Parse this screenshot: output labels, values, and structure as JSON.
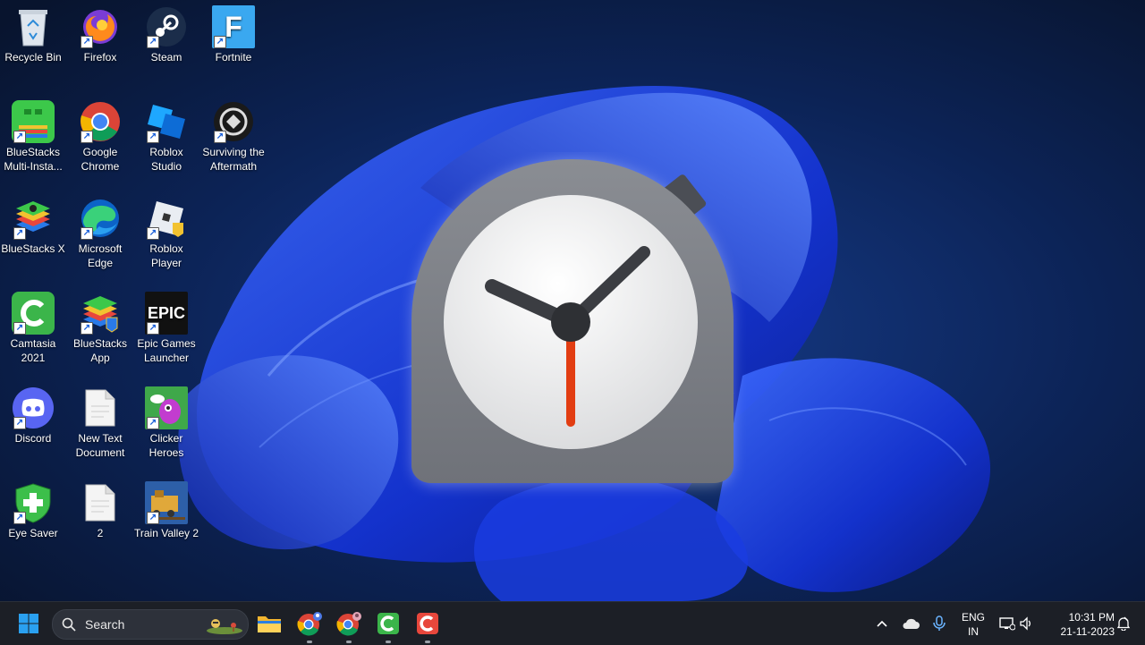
{
  "desktop": {
    "icons": [
      {
        "label": "Recycle Bin",
        "icon": "recycle-bin-icon"
      },
      {
        "label": "Firefox",
        "icon": "firefox-icon"
      },
      {
        "label": "Steam",
        "icon": "steam-icon"
      },
      {
        "label": "Fortnite",
        "icon": "fortnite-icon"
      },
      {
        "label": "BlueStacks Multi-Insta...",
        "icon": "bluestacks-multi-instance-icon"
      },
      {
        "label": "Google Chrome",
        "icon": "chrome-icon"
      },
      {
        "label": "Roblox Studio",
        "icon": "roblox-studio-icon"
      },
      {
        "label": "Surviving the Aftermath",
        "icon": "surviving-the-aftermath-icon"
      },
      {
        "label": "BlueStacks X",
        "icon": "bluestacks-x-icon"
      },
      {
        "label": "Microsoft Edge",
        "icon": "edge-icon"
      },
      {
        "label": "Roblox Player",
        "icon": "roblox-player-icon"
      },
      {
        "label": "Camtasia 2021",
        "icon": "camtasia-icon"
      },
      {
        "label": "BlueStacks App",
        "icon": "bluestacks-app-icon"
      },
      {
        "label": "Epic Games Launcher",
        "icon": "epic-games-icon"
      },
      {
        "label": "Discord",
        "icon": "discord-icon"
      },
      {
        "label": "New Text Document",
        "icon": "text-document-icon"
      },
      {
        "label": "Clicker Heroes",
        "icon": "clicker-heroes-icon"
      },
      {
        "label": "Eye Saver",
        "icon": "eye-saver-icon"
      },
      {
        "label": "2",
        "icon": "text-document-icon"
      },
      {
        "label": "Train Valley 2",
        "icon": "train-valley-icon"
      }
    ],
    "fortnite_letter": "F",
    "epic_text": "EPIC"
  },
  "taskbar": {
    "search_label": "Search",
    "tray": {
      "language_line1": "ENG",
      "language_line2": "IN",
      "time": "10:31 PM",
      "date": "21-11-2023"
    }
  },
  "colors": {
    "taskbar_bg": "#1c1f26",
    "clock_hand_second": "#e23d12",
    "clock_body": "#7d8087",
    "windows_accent": "#2aa0f0"
  }
}
